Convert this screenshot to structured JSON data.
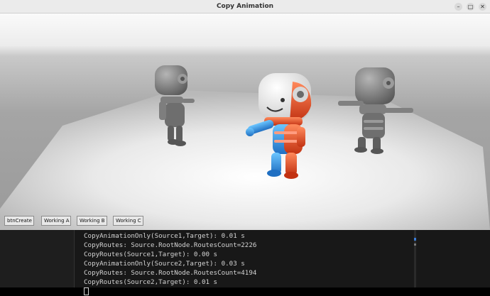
{
  "window": {
    "title": "Copy Animation",
    "minimize_glyph": "–",
    "maximize_glyph": "□",
    "close_glyph": "✕"
  },
  "toolbar": {
    "buttons": [
      {
        "label": "btnCreate"
      },
      {
        "label": "Working A"
      },
      {
        "label": "Working B"
      },
      {
        "label": "Working C"
      }
    ]
  },
  "console": {
    "lines": [
      "CopyAnimationOnly(Source1,Target): 0.01 s",
      "CopyRoutes: Source.RootNode.RoutesCount=2226",
      "CopyRoutes(Source1,Target): 0.00 s",
      "CopyAnimationOnly(Source2,Target): 0.03 s",
      "CopyRoutes: Source.RootNode.RoutesCount=4194",
      "CopyRoutes(Source2,Target): 0.01 s"
    ]
  },
  "colors": {
    "accent_blue": "#2f8fe0",
    "accent_orange": "#ea4a22",
    "robot_gray": "#7e7e7e"
  }
}
